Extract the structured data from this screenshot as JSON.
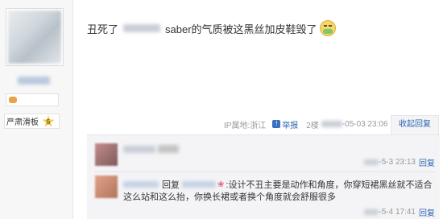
{
  "user": {
    "level_name": "严肃滑板",
    "level_num": "5"
  },
  "post": {
    "text_before": "丑死了",
    "text_after": "saber的气质被这黑丝加皮鞋毁了",
    "emoji": "nausea-emoji"
  },
  "meta": {
    "ip_location": "IP属地:浙江",
    "report_label": "举报",
    "floor": "2楼",
    "datetime_suffix": "-05-03 23:06",
    "collapse_label": "收起回复"
  },
  "replies": [
    {
      "time_suffix": "-5-3 23:13",
      "reply_label": "回复"
    },
    {
      "reply_word": "回复",
      "text_line1": ":设计不丑主要是动作和角度，你穿短裙黑丝就不适合",
      "text_line2": "这么站和这么抬，你换长裙或者换个角度就会舒服很多",
      "time_suffix": "-5-4 17:41",
      "reply_label": "回复"
    }
  ],
  "colors": {
    "link_blue": "#2d64b3",
    "panel_bg": "#f4f4f6"
  }
}
